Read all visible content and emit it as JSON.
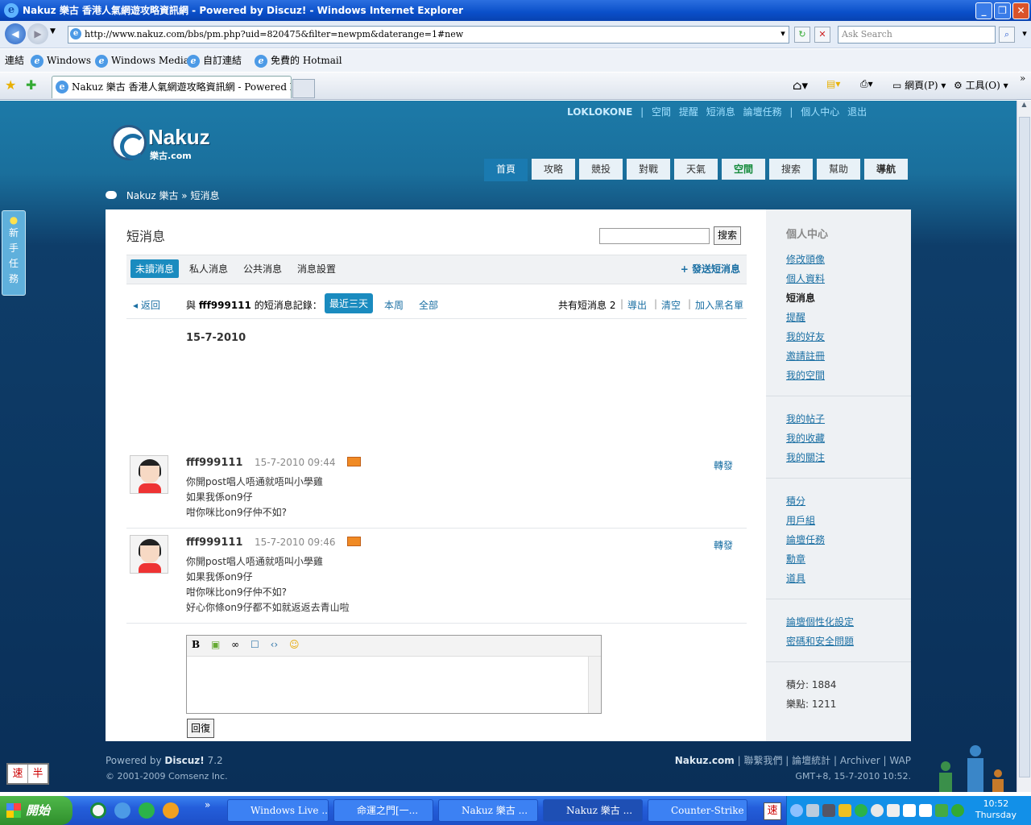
{
  "browser": {
    "title": "Nakuz 樂古 香港人氣網遊攻略資訊網 - Powered by Discuz! - Windows Internet Explorer",
    "url": "http://www.nakuz.com/bbs/pm.php?uid=820475&filter=newpm&daterange=1#new",
    "search_placeholder": "Ask Search",
    "links_label": "連結",
    "links": [
      "Windows",
      "Windows Media",
      "自訂連結",
      "免費的 Hotmail"
    ],
    "tab_title": "Nakuz 樂古 香港人氣網遊攻略資訊網 - Powered by ...",
    "cmd_page": "網頁(P)",
    "cmd_tools": "工具(O)"
  },
  "site": {
    "user": "LOKLOKONE",
    "top_links": [
      "空間",
      "提醒",
      "短消息",
      "論壇任務",
      "個人中心",
      "退出"
    ],
    "logo": "Nakuz",
    "logo_sub": "樂古.com",
    "nav": [
      "首頁",
      "攻略",
      "競投",
      "對戰",
      "天氣",
      "空間",
      "搜索",
      "幫助",
      "導航"
    ],
    "breadcrumb_home": "Nakuz 樂古",
    "breadcrumb_sep": "»",
    "breadcrumb_current": "短消息",
    "side_tip": [
      "新",
      "手",
      "任",
      "務"
    ]
  },
  "pm": {
    "title": "短消息",
    "search_button": "搜索",
    "tabs": [
      "未讀消息",
      "私人消息",
      "公共消息",
      "消息設置"
    ],
    "send": "+ 發送短消息",
    "back": "返回",
    "record_prefix": "與",
    "record_user": "fff999111",
    "record_suffix": "的短消息記錄：",
    "ranges": [
      "最近三天",
      "本周",
      "全部"
    ],
    "count_label": "共有短消息 2",
    "export": "導出",
    "clear": "清空",
    "blacklist": "加入黑名單",
    "date": "15-7-2010",
    "forward": "轉發",
    "messages": [
      {
        "from": "fff999111",
        "time": "15-7-2010 09:44",
        "lines": [
          "你開post唱人唔通就唔叫小學雞",
          "如果我係on9仔",
          "咁你咪比on9仔仲不如?"
        ]
      },
      {
        "from": "fff999111",
        "time": "15-7-2010 09:46",
        "lines": [
          "你開post唱人唔通就唔叫小學雞",
          "如果我係on9仔",
          "咁你咪比on9仔仲不如?",
          "好心你條on9仔都不如就返返去青山啦"
        ]
      }
    ],
    "editor_tools": [
      "B",
      "▣",
      "∞",
      "☐",
      "‹›",
      "☺"
    ],
    "reply": "回復"
  },
  "sidebar": {
    "heading": "個人中心",
    "group1": [
      "修改頭像",
      "個人資料",
      "短消息",
      "提醒",
      "我的好友",
      "邀請註冊",
      "我的空間"
    ],
    "group2": [
      "我的帖子",
      "我的收藏",
      "我的關注"
    ],
    "group3": [
      "積分",
      "用戶組",
      "論壇任務",
      "勳章",
      "道具"
    ],
    "group4": [
      "論壇個性化設定",
      "密碼和安全問題"
    ],
    "points": "積分: 1884",
    "fun_points": "樂點: 1211"
  },
  "footer": {
    "powered": "Powered by",
    "discuz": "Discuz!",
    "version": "7.2",
    "copyright": "© 2001-2009 Comsenz Inc.",
    "brand": "Nakuz.com",
    "links": "| 聯繫我們 | 論壇統計 | Archiver | WAP",
    "time": "GMT+8, 15-7-2010 10:52."
  },
  "ime": [
    "速",
    "半"
  ],
  "taskbar": {
    "start": "開始",
    "tasks": [
      "Windows Live ...",
      "命運之門[一...",
      "Nakuz 樂古 ...",
      "Nakuz 樂古 ...",
      "Counter-Strike ..."
    ],
    "clock": "10:52",
    "day": "Thursday"
  }
}
